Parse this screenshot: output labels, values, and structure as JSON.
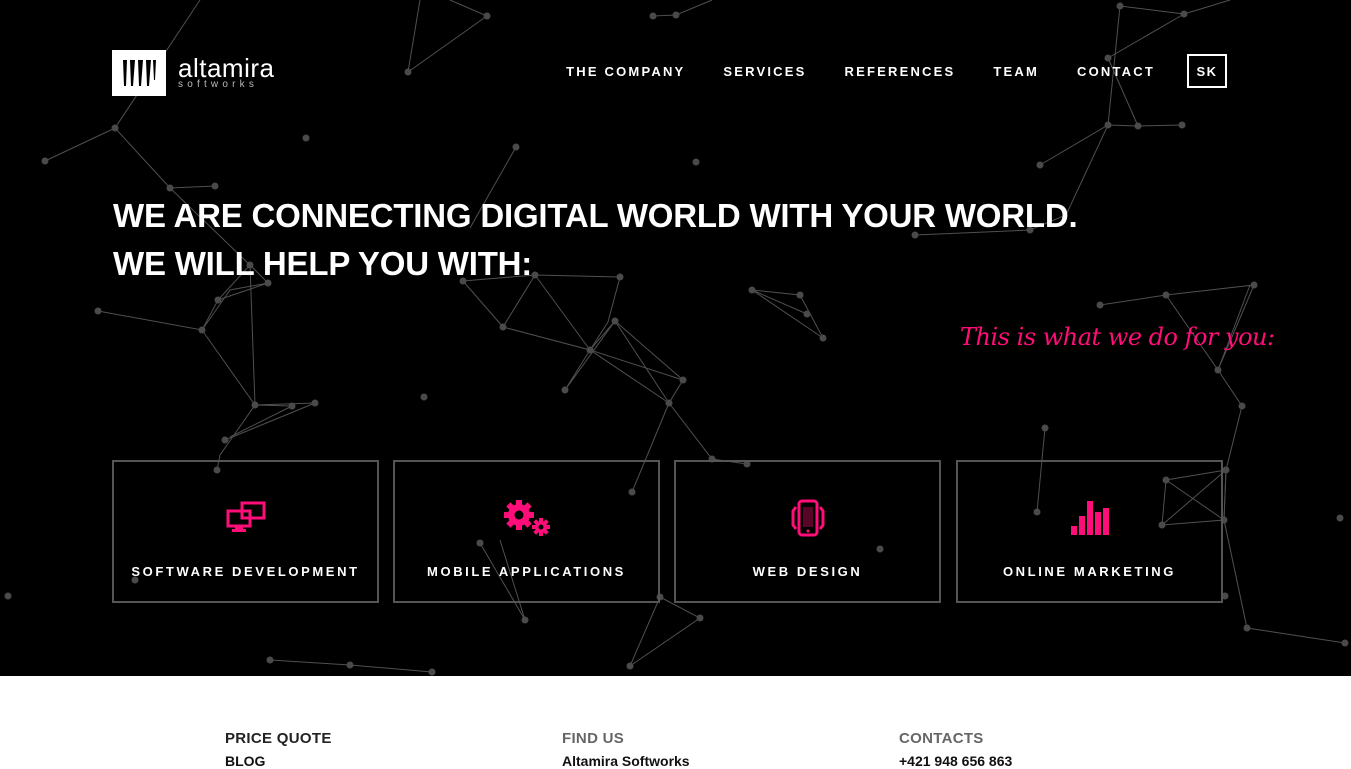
{
  "brand": {
    "name": "altamira",
    "sub": "softworks",
    "logo_icon": "altamira-mark-icon"
  },
  "nav": {
    "items": [
      "THE COMPANY",
      "SERVICES",
      "REFERENCES",
      "TEAM",
      "CONTACT"
    ],
    "lang": "SK"
  },
  "hero": {
    "line1": "WE ARE CONNECTING DIGITAL WORLD WITH YOUR WORLD.",
    "line2": "WE WILL HELP YOU WITH:",
    "tagline": "This is what we do for you:"
  },
  "services": [
    {
      "label": "SOFTWARE DEVELOPMENT",
      "icon": "monitors-icon"
    },
    {
      "label": "MOBILE APPLICATIONS",
      "icon": "gears-icon"
    },
    {
      "label": "WEB DESIGN",
      "icon": "phone-icon"
    },
    {
      "label": "ONLINE MARKETING",
      "icon": "bar-chart-icon"
    }
  ],
  "footer": {
    "col1": {
      "title": "PRICE QUOTE",
      "line": "BLOG"
    },
    "col2": {
      "title": "FIND US",
      "line": "Altamira Softworks"
    },
    "col3": {
      "title": "CONTACTS",
      "line": "+421 948 656 863"
    }
  },
  "colors": {
    "accent": "#ff0d78",
    "background": "#000000",
    "card_border": "#555555",
    "network_line": "#555555"
  }
}
